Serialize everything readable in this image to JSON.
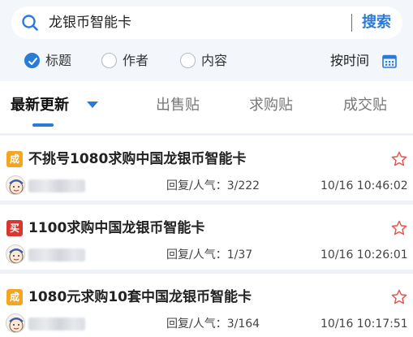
{
  "search": {
    "query": "龙银币智能卡",
    "button": "搜索",
    "icon": "search-icon"
  },
  "filters": {
    "options": [
      {
        "label": "标题",
        "checked": true
      },
      {
        "label": "作者",
        "checked": false
      },
      {
        "label": "内容",
        "checked": false
      }
    ],
    "sort_label": "按时间",
    "sort_icon": "calendar-icon"
  },
  "tabs": [
    {
      "label": "最新更新",
      "active": true
    },
    {
      "label": "出售贴",
      "active": false
    },
    {
      "label": "求购贴",
      "active": false
    },
    {
      "label": "成交贴",
      "active": false
    }
  ],
  "colors": {
    "accent": "#2a7ad8",
    "badge_done": "#f4a623",
    "badge_buy": "#d9362f",
    "star": "#e8534f"
  },
  "posts": [
    {
      "badge": "成",
      "badge_type": "done",
      "title": "不挑号1080求购中国龙银币智能卡",
      "stats": "回复/人气：3/222",
      "time": "10/16 10:46:02"
    },
    {
      "badge": "买",
      "badge_type": "buy",
      "title": "1100求购中国龙银币智能卡",
      "stats": "回复/人气：1/37",
      "time": "10/16 10:26:01"
    },
    {
      "badge": "成",
      "badge_type": "done",
      "title": "1080元求购10套中国龙银币智能卡",
      "stats": "回复/人气：3/164",
      "time": "10/16 10:17:51"
    }
  ]
}
